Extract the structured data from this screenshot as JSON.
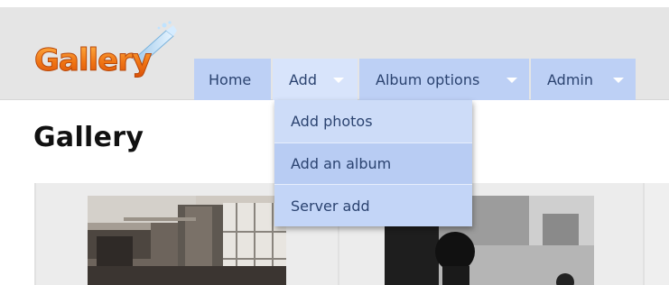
{
  "logo": {
    "text": "Gallery",
    "icon": "pen-sparkle-icon"
  },
  "nav": {
    "items": [
      {
        "label": "Home"
      },
      {
        "label": "Add",
        "icon": "caret-down-icon"
      },
      {
        "label": "Album options",
        "icon": "caret-down-icon"
      },
      {
        "label": "Admin",
        "icon": "caret-down-icon"
      }
    ]
  },
  "dropdown": {
    "items": [
      {
        "label": "Add photos"
      },
      {
        "label": "Add an album"
      },
      {
        "label": "Server add"
      }
    ]
  },
  "page": {
    "title": "Gallery"
  },
  "colors": {
    "header_bg": "#e5e5e5",
    "nav_bg": "#bdd0f5",
    "nav_active_bg": "#d8e4fb",
    "nav_text": "#2b4370",
    "logo_orange": "#f06f15"
  }
}
